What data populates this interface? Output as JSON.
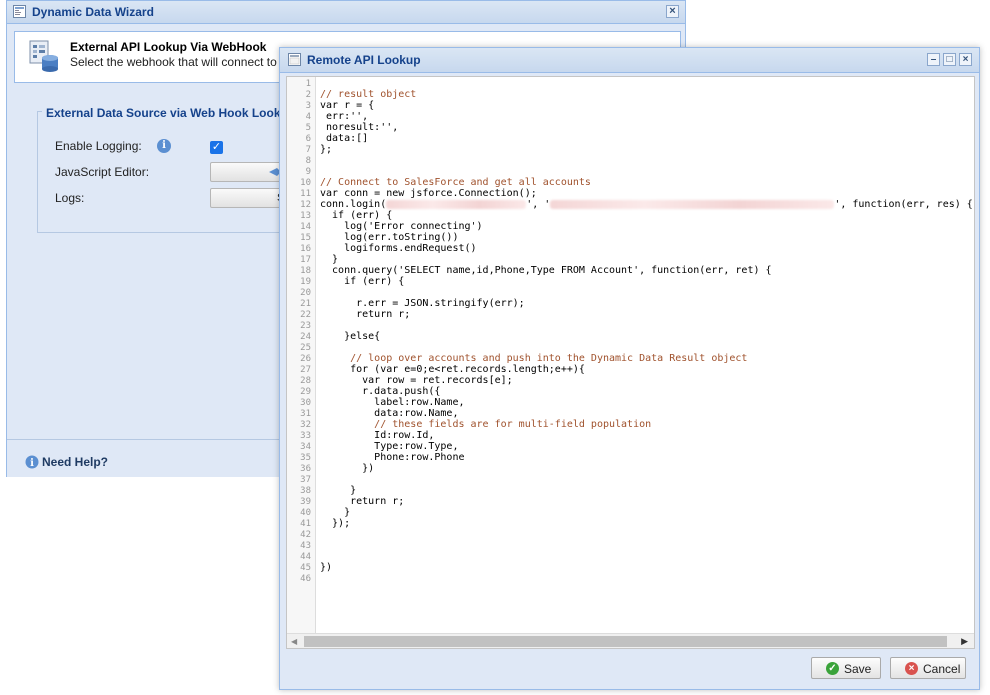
{
  "wizard": {
    "title": "Dynamic Data Wizard",
    "header_title": "External API Lookup Via WebHook",
    "header_subtitle": "Select the webhook that will connect to your",
    "fieldset_legend": "External Data Source via Web Hook Lookup",
    "enable_logging_label": "Enable Logging:",
    "enable_logging_checked": true,
    "javascript_editor_label": "JavaScript Editor:",
    "logs_label": "Logs:",
    "logs_button_fragment": "S",
    "help_label": "Need Help?"
  },
  "api_window": {
    "title": "Remote API Lookup",
    "save_label": "Save",
    "cancel_label": "Cancel",
    "line_count": 46,
    "code_lines": [
      {
        "n": 1,
        "text": ""
      },
      {
        "n": 2,
        "text": "// result object"
      },
      {
        "n": 3,
        "text": "var r = {"
      },
      {
        "n": 4,
        "text": " err:'',"
      },
      {
        "n": 5,
        "text": " noresult:'',"
      },
      {
        "n": 6,
        "text": " data:[]"
      },
      {
        "n": 7,
        "text": "};"
      },
      {
        "n": 8,
        "text": ""
      },
      {
        "n": 9,
        "text": ""
      },
      {
        "n": 10,
        "text": "// Connect to SalesForce and get all accounts"
      },
      {
        "n": 11,
        "text": "var conn = new jsforce.Connection();"
      },
      {
        "n": 12,
        "text": "conn.login(",
        "redacted_after": "', '",
        "tail": "', function(err, res) {"
      },
      {
        "n": 13,
        "text": "  if (err) {"
      },
      {
        "n": 14,
        "text": "    log('Error connecting')"
      },
      {
        "n": 15,
        "text": "    log(err.toString())"
      },
      {
        "n": 16,
        "text": "    logiforms.endRequest()"
      },
      {
        "n": 17,
        "text": "  }"
      },
      {
        "n": 18,
        "text": "  conn.query('SELECT name,id,Phone,Type FROM Account', function(err, ret) {"
      },
      {
        "n": 19,
        "text": "    if (err) {"
      },
      {
        "n": 20,
        "text": ""
      },
      {
        "n": 21,
        "text": "      r.err = JSON.stringify(err);"
      },
      {
        "n": 22,
        "text": "      return r;"
      },
      {
        "n": 23,
        "text": ""
      },
      {
        "n": 24,
        "text": "    }else{"
      },
      {
        "n": 25,
        "text": ""
      },
      {
        "n": 26,
        "text": "     // loop over accounts and push into the Dynamic Data Result object"
      },
      {
        "n": 27,
        "text": "     for (var e=0;e<ret.records.length;e++){"
      },
      {
        "n": 28,
        "text": "       var row = ret.records[e];"
      },
      {
        "n": 29,
        "text": "       r.data.push({"
      },
      {
        "n": 30,
        "text": "         label:row.Name,"
      },
      {
        "n": 31,
        "text": "         data:row.Name,"
      },
      {
        "n": 32,
        "text": "         // these fields are for multi-field population"
      },
      {
        "n": 33,
        "text": "         Id:row.Id,"
      },
      {
        "n": 34,
        "text": "         Type:row.Type,"
      },
      {
        "n": 35,
        "text": "         Phone:row.Phone"
      },
      {
        "n": 36,
        "text": "       })"
      },
      {
        "n": 37,
        "text": ""
      },
      {
        "n": 38,
        "text": "     }"
      },
      {
        "n": 39,
        "text": "     return r;"
      },
      {
        "n": 40,
        "text": "    }"
      },
      {
        "n": 41,
        "text": "  });"
      },
      {
        "n": 42,
        "text": ""
      },
      {
        "n": 43,
        "text": ""
      },
      {
        "n": 44,
        "text": ""
      },
      {
        "n": 45,
        "text": "})"
      },
      {
        "n": 46,
        "text": ""
      }
    ]
  },
  "colors": {
    "window_bg": "#dfe8f6",
    "title_text": "#15428b",
    "border": "#99bbe8",
    "comment": "#a0522d",
    "string": "#a31515",
    "keyword": "#1a1aa6",
    "save_icon": "#3aa33a",
    "cancel_icon": "#d9534f"
  },
  "icons": {
    "wizard_title": "window-icon",
    "header": "database-icon",
    "info": "info-icon",
    "help": "help-icon",
    "save": "check-circle-icon",
    "cancel": "x-circle-icon"
  }
}
